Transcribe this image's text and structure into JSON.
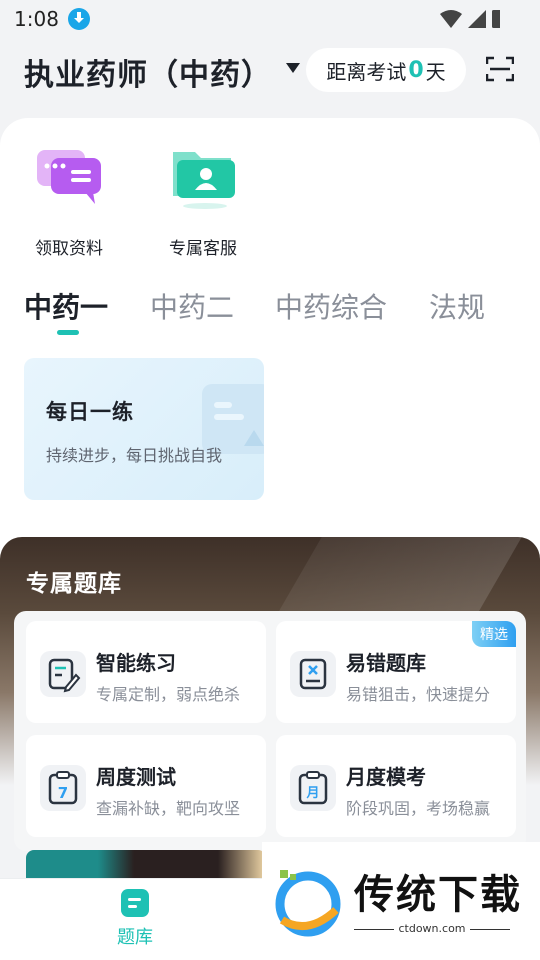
{
  "status_bar": {
    "time": "1:08"
  },
  "header": {
    "title": "执业药师（中药）",
    "countdown_prefix": "距离考试",
    "countdown_days": "0",
    "countdown_suffix": "天"
  },
  "shortcuts": [
    {
      "label": "领取资料",
      "icon": "chat-bubble-icon",
      "color": "#c46cf0"
    },
    {
      "label": "专属客服",
      "icon": "contact-folder-icon",
      "color": "#22c7a5"
    }
  ],
  "tabs": [
    {
      "label": "中药一",
      "active": true
    },
    {
      "label": "中药二",
      "active": false
    },
    {
      "label": "中药综合",
      "active": false
    },
    {
      "label": "法规",
      "active": false
    }
  ],
  "daily": {
    "title": "每日一练",
    "subtitle": "持续进步，每日挑战自我"
  },
  "bank": {
    "title": "专属题库",
    "tiles": [
      {
        "name": "智能练习",
        "desc": "专属定制，弱点绝杀",
        "icon": "edit-note-icon",
        "badge": ""
      },
      {
        "name": "易错题库",
        "desc": "易错狙击，快速提分",
        "icon": "error-note-icon",
        "badge": "精选"
      },
      {
        "name": "周度测试",
        "desc": "查漏补缺，靶向攻坚",
        "icon": "weekly-clipboard-icon",
        "icon_text": "7",
        "badge": ""
      },
      {
        "name": "月度模考",
        "desc": "阶段巩固，考场稳赢",
        "icon": "monthly-clipboard-icon",
        "icon_text": "月",
        "badge": ""
      }
    ]
  },
  "bottom_nav": [
    {
      "label": "题库",
      "active": true
    }
  ],
  "watermark": {
    "text": "传统下载",
    "url": "ctdown.com"
  },
  "colors": {
    "accent": "#1ec1b4",
    "badge": "#2f9ff0"
  }
}
